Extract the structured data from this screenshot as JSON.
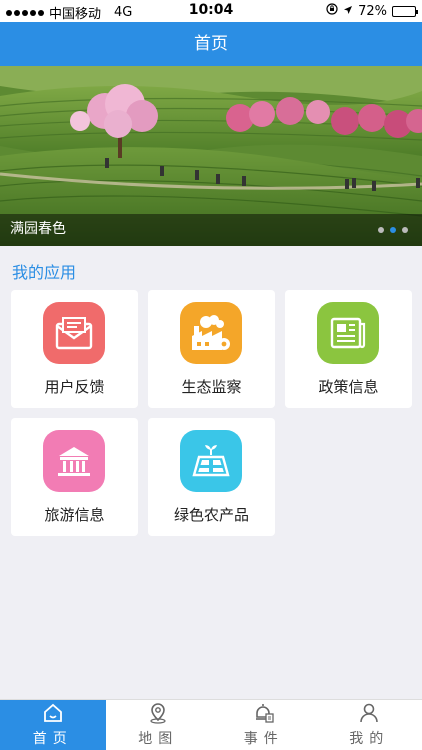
{
  "status_bar": {
    "carrier": "中国移动",
    "network": "4G",
    "time": "10:04",
    "battery_percent": "72%",
    "battery_level": 0.72
  },
  "nav_bar": {
    "title": "首页"
  },
  "banner": {
    "caption": "满园春色",
    "slide_count": 3,
    "active_slide": 2
  },
  "apps_section": {
    "title": "我的应用",
    "apps": [
      {
        "label": "用户反馈",
        "icon": "mail-icon",
        "color": "#f06b6b"
      },
      {
        "label": "生态监察",
        "icon": "factory-icon",
        "color": "#f4a629"
      },
      {
        "label": "政策信息",
        "icon": "newspaper-icon",
        "color": "#8bc53f"
      },
      {
        "label": "旅游信息",
        "icon": "pavilion-icon",
        "color": "#f27cb4"
      },
      {
        "label": "绿色农产品",
        "icon": "farmland-icon",
        "color": "#3ac6e8"
      }
    ]
  },
  "tab_bar": {
    "tabs": [
      {
        "label": "首页",
        "icon": "home-icon"
      },
      {
        "label": "地图",
        "icon": "map-pin-icon"
      },
      {
        "label": "事件",
        "icon": "event-icon"
      },
      {
        "label": "我的",
        "icon": "person-icon"
      }
    ],
    "active": 0
  }
}
